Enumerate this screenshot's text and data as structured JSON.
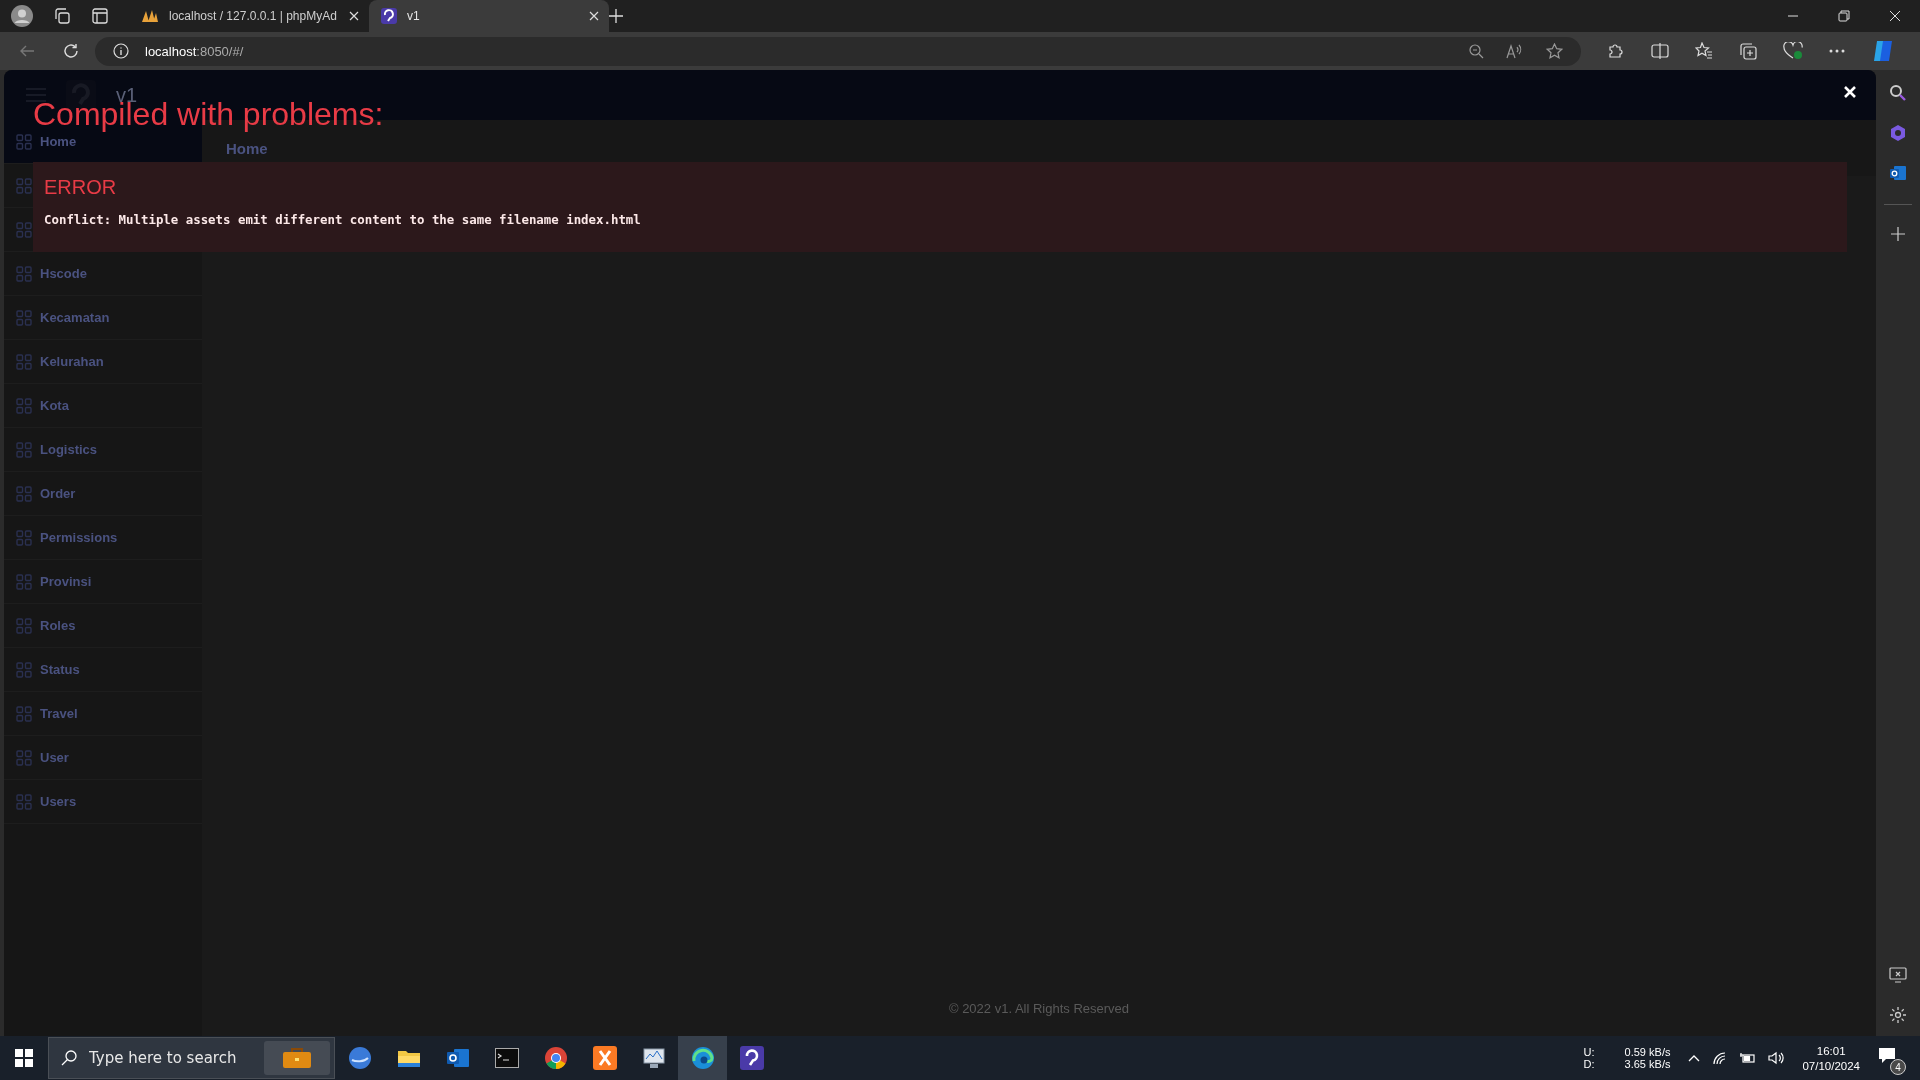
{
  "browser": {
    "tabs": [
      {
        "title": "localhost / 127.0.0.1 | phpMyAd",
        "kind": "phpmyadmin",
        "selected": false
      },
      {
        "title": "v1",
        "kind": "app",
        "selected": true
      }
    ],
    "address": {
      "host": "localhost",
      "rest": ":8050/#/"
    }
  },
  "app": {
    "brand": "v1",
    "sidebar": {
      "items": [
        {
          "label": "Home",
          "selected": true
        },
        {
          "selected": false
        },
        {
          "selected": false
        },
        {
          "label": "Hscode",
          "selected": false
        },
        {
          "label": "Kecamatan",
          "selected": false
        },
        {
          "label": "Kelurahan",
          "selected": false
        },
        {
          "label": "Kota",
          "selected": false
        },
        {
          "label": "Logistics",
          "selected": false
        },
        {
          "label": "Order",
          "selected": false
        },
        {
          "label": "Permissions",
          "selected": false
        },
        {
          "label": "Provinsi",
          "selected": false
        },
        {
          "label": "Roles",
          "selected": false
        },
        {
          "label": "Status",
          "selected": false
        },
        {
          "label": "Travel",
          "selected": false
        },
        {
          "label": "User",
          "selected": false
        },
        {
          "label": "Users",
          "selected": false
        }
      ]
    },
    "breadcrumb": "Home",
    "footer": "© 2022 v1. All Rights Reserved"
  },
  "overlay": {
    "title": "Compiled with problems:",
    "errors": [
      {
        "heading": "ERROR",
        "message": "Conflict: Multiple assets emit different content to the same filename index.html"
      }
    ]
  },
  "taskbar": {
    "search": {
      "placeholder": "Type here to search"
    },
    "apps": [
      {
        "kind": "mikrotik",
        "selected": false
      },
      {
        "kind": "folder",
        "selected": false
      },
      {
        "kind": "outlook",
        "selected": false
      },
      {
        "kind": "terminal",
        "selected": false
      },
      {
        "kind": "chrome",
        "selected": false
      },
      {
        "kind": "xampp",
        "selected": false
      },
      {
        "kind": "monitor",
        "selected": false
      },
      {
        "kind": "edge",
        "selected": true
      },
      {
        "kind": "app",
        "selected": false
      }
    ],
    "network": {
      "upload_label": "U:",
      "upload": "0.59 kB/s",
      "download_label": "D:",
      "download": "3.65 kB/s"
    },
    "time": "16:01",
    "date": "07/10/2024",
    "notifications": "4"
  }
}
